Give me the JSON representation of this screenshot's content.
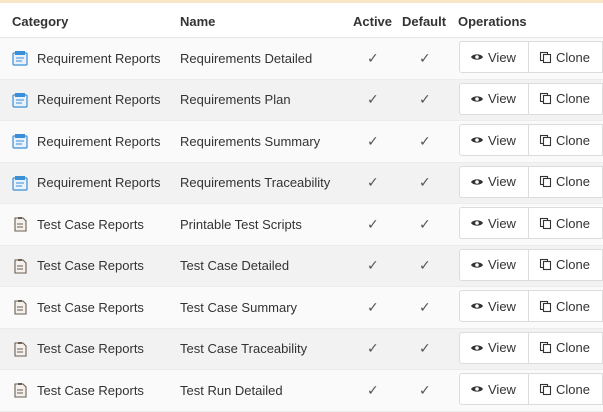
{
  "table": {
    "headers": {
      "category": "Category",
      "name": "Name",
      "active": "Active",
      "default": "Default",
      "operations": "Operations"
    },
    "rows": [
      {
        "category": "Requirement Reports",
        "category_icon": "requirement-report-icon",
        "name": "Requirements Detailed",
        "active": "✓",
        "default": "✓",
        "view": "View",
        "clone": "Clone"
      },
      {
        "category": "Requirement Reports",
        "category_icon": "requirement-report-icon",
        "name": "Requirements Plan",
        "active": "✓",
        "default": "✓",
        "view": "View",
        "clone": "Clone"
      },
      {
        "category": "Requirement Reports",
        "category_icon": "requirement-report-icon",
        "name": "Requirements Summary",
        "active": "✓",
        "default": "✓",
        "view": "View",
        "clone": "Clone"
      },
      {
        "category": "Requirement Reports",
        "category_icon": "requirement-report-icon",
        "name": "Requirements Traceability",
        "active": "✓",
        "default": "✓",
        "view": "View",
        "clone": "Clone"
      },
      {
        "category": "Test Case Reports",
        "category_icon": "test-case-report-icon",
        "name": "Printable Test Scripts",
        "active": "✓",
        "default": "✓",
        "view": "View",
        "clone": "Clone"
      },
      {
        "category": "Test Case Reports",
        "category_icon": "test-case-report-icon",
        "name": "Test Case Detailed",
        "active": "✓",
        "default": "✓",
        "view": "View",
        "clone": "Clone"
      },
      {
        "category": "Test Case Reports",
        "category_icon": "test-case-report-icon",
        "name": "Test Case Summary",
        "active": "✓",
        "default": "✓",
        "view": "View",
        "clone": "Clone"
      },
      {
        "category": "Test Case Reports",
        "category_icon": "test-case-report-icon",
        "name": "Test Case Traceability",
        "active": "✓",
        "default": "✓",
        "view": "View",
        "clone": "Clone"
      },
      {
        "category": "Test Case Reports",
        "category_icon": "test-case-report-icon",
        "name": "Test Run Detailed",
        "active": "✓",
        "default": "✓",
        "view": "View",
        "clone": "Clone"
      }
    ]
  },
  "icons": {
    "view": "eye-icon",
    "clone": "clone-icon"
  },
  "colors": {
    "header_rule": "#f8e6c9",
    "row_alt": "#f2f2f2",
    "requirement_icon": "#3b8fd6"
  }
}
